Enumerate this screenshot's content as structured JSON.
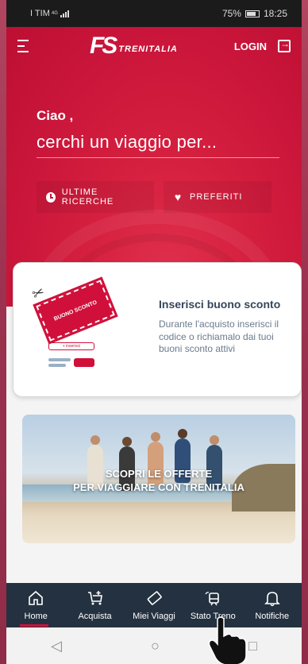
{
  "status_bar": {
    "carrier": "I TIM",
    "network": "4G",
    "battery": "75%",
    "time": "18:25"
  },
  "header": {
    "logo_mark": "FS",
    "logo_text": "TRENITALIA",
    "login_label": "LOGIN"
  },
  "hero": {
    "greeting": "Ciao ,",
    "subtitle": "cerchi un viaggio per...",
    "recent_searches_label": "ULTIME RICERCHE",
    "favorites_label": "PREFERITI"
  },
  "voucher_card": {
    "ticket_text": "BUONO SCONTO",
    "input_text": "+ inserisci",
    "title": "Inserisci buono sconto",
    "description": "Durante l'acquisto inserisci il codice o richiamalo dai tuoi buoni sconto attivi"
  },
  "promo": {
    "line1": "SCOPRI LE OFFERTE",
    "line2": "PER VIAGGIARE CON TRENITALIA"
  },
  "bottom_nav": {
    "items": [
      {
        "label": "Home",
        "icon": "home-icon",
        "active": true
      },
      {
        "label": "Acquista",
        "icon": "cart-icon"
      },
      {
        "label": "Miei Viaggi",
        "icon": "ticket-icon"
      },
      {
        "label": "Stato Treno",
        "icon": "train-icon"
      },
      {
        "label": "Notifiche",
        "icon": "bell-icon"
      }
    ]
  },
  "colors": {
    "brand_red": "#c9153a",
    "nav_bg": "#243140"
  }
}
